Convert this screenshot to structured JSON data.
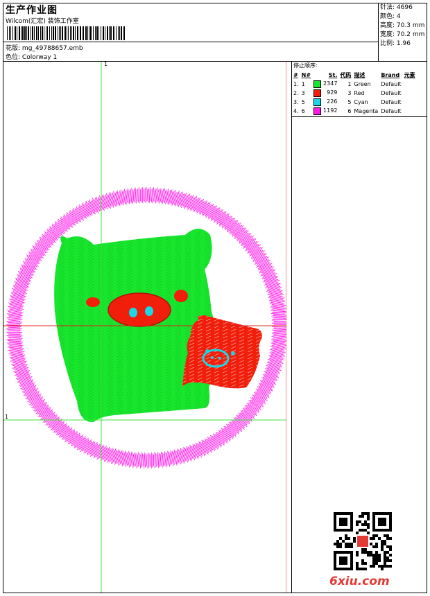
{
  "header": {
    "title": "生产作业图",
    "company": "Wilcom(汇宏) 装饰工作室",
    "design_label": "花版:",
    "design_value": "mg_49788657.emb",
    "colorway_label": "色位:",
    "colorway_value": "Colorway 1"
  },
  "specs": {
    "stitches_label": "针法:",
    "stitches_value": "4696",
    "colors_label": "颜色:",
    "colors_value": "4",
    "height_label": "高度:",
    "height_value": "70.3 mm",
    "width_label": "宽度:",
    "width_value": "70.2 mm",
    "ratio_label": "比例:",
    "ratio_value": "1.96"
  },
  "sequence": {
    "heading": "停止顺序:",
    "columns": [
      "#",
      "N#",
      "St.",
      "代码",
      "描述",
      "Brand",
      "元素"
    ],
    "rows": [
      {
        "idx": "1.",
        "n": "1",
        "color": "#18e62d",
        "st": "2347",
        "code": "1",
        "desc": "Green",
        "brand": "Default"
      },
      {
        "idx": "2.",
        "n": "3",
        "color": "#f01e0a",
        "st": "929",
        "code": "3",
        "desc": "Red",
        "brand": "Default"
      },
      {
        "idx": "3.",
        "n": "5",
        "color": "#18d8e8",
        "st": "226",
        "code": "5",
        "desc": "Cyan",
        "brand": "Default"
      },
      {
        "idx": "4.",
        "n": "6",
        "color": "#ff18e8",
        "st": "1192",
        "code": "6",
        "desc": "Magenta",
        "brand": "Default"
      }
    ]
  },
  "guides": {
    "top_marker": "1",
    "left_marker": "1"
  },
  "watermark": {
    "site": "6xiu.com"
  },
  "colors": {
    "green": "#18e62d",
    "red": "#f01e0a",
    "cyan": "#18d8e8",
    "magenta": "#ff18e8",
    "guide_green": "#3ce03c",
    "guide_red": "#e02020"
  }
}
